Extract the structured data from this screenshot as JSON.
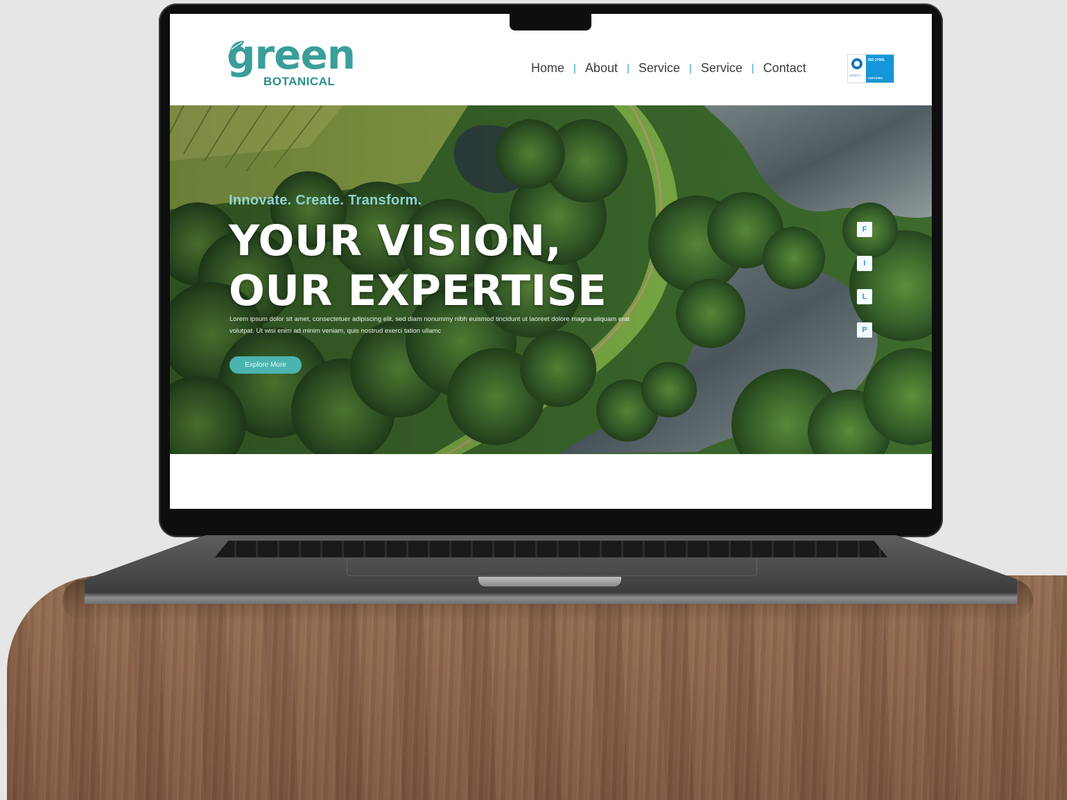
{
  "site": {
    "logo": {
      "word": "green",
      "sub": "BOTANICAL"
    },
    "nav": [
      "Home",
      "About",
      "Service",
      "Service",
      "Contact"
    ],
    "nav_separator": "|",
    "badge": {
      "name": "ISO 27001",
      "text": "ISO 27001",
      "sub": "CERTIFIED",
      "issuer": "QUALITY"
    }
  },
  "hero": {
    "tagline": "Innovate. Create. Transform.",
    "headline_line1": "YOUR VISION,",
    "headline_line2": "OUR EXPERTISE",
    "body": "Lorem ipsum dolor sit amet, consectetuer adipiscing elit, sed diam nonummy nibh euismod tincidunt ut laoreet dolore magna aliquam erat volutpat. Ut wisi enim ad minim veniam, quis nostrud exerci tation ullamc",
    "cta": "Explore More"
  },
  "social": [
    "F",
    "I",
    "L",
    "P"
  ],
  "colors": {
    "brand_teal": "#3a9e9a",
    "accent_blue": "#2fa3d9",
    "button": "#4bb4b0",
    "badge_blue": "#1596d8"
  },
  "icons": [
    "leaf-icon",
    "quality-badge-icon",
    "facebook-icon",
    "instagram-icon",
    "linkedin-icon",
    "pinterest-icon"
  ]
}
